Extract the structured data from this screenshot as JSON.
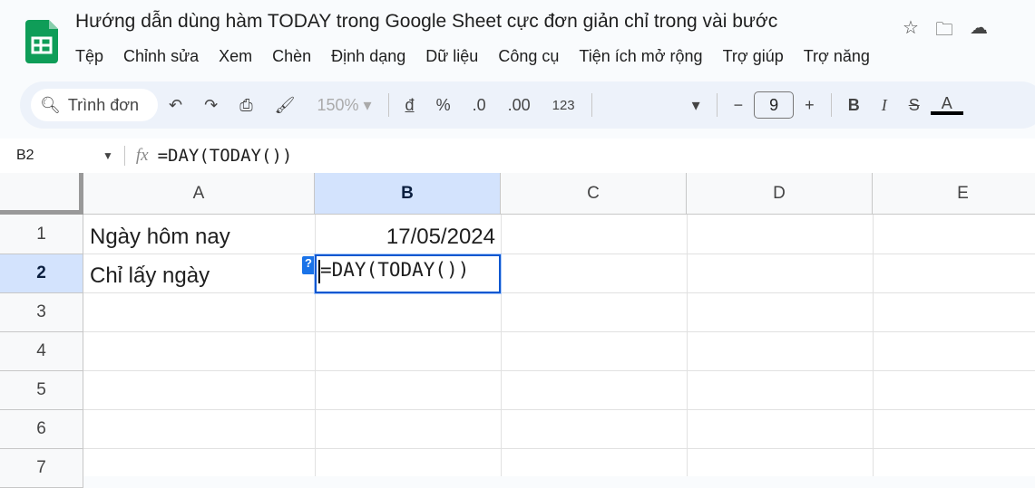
{
  "doc_title": "Hướng dẫn dùng hàm TODAY trong Google Sheet cực đơn giản chỉ trong vài bước",
  "menu": [
    "Tệp",
    "Chỉnh sửa",
    "Xem",
    "Chèn",
    "Định dạng",
    "Dữ liệu",
    "Công cụ",
    "Tiện ích mở rộng",
    "Trợ giúp",
    "Trợ năng"
  ],
  "toolbar": {
    "search": "Trình đơn",
    "zoom": "150%",
    "currency": "đ",
    "percent": "%",
    "dec_less": ".0",
    "dec_more": ".00",
    "format_num": "123",
    "font_size": "9",
    "bold": "B",
    "italic": "I",
    "text_color": "A"
  },
  "formula_bar": {
    "cell_ref": "B2",
    "fx": "fx",
    "formula": "=DAY(TODAY())"
  },
  "columns": [
    "A",
    "B",
    "C",
    "D",
    "E"
  ],
  "rows": [
    "1",
    "2",
    "3",
    "4",
    "5",
    "6",
    "7"
  ],
  "cells": {
    "A1": "Ngày hôm nay",
    "B1": "17/05/2024",
    "A2": "Chỉ lấy ngày",
    "B2": "=DAY(TODAY())"
  },
  "help_badge": "?",
  "colors": {
    "accent": "#0b57d0",
    "selected_header": "#d3e3fd",
    "sheets_green": "#0f9d58"
  }
}
